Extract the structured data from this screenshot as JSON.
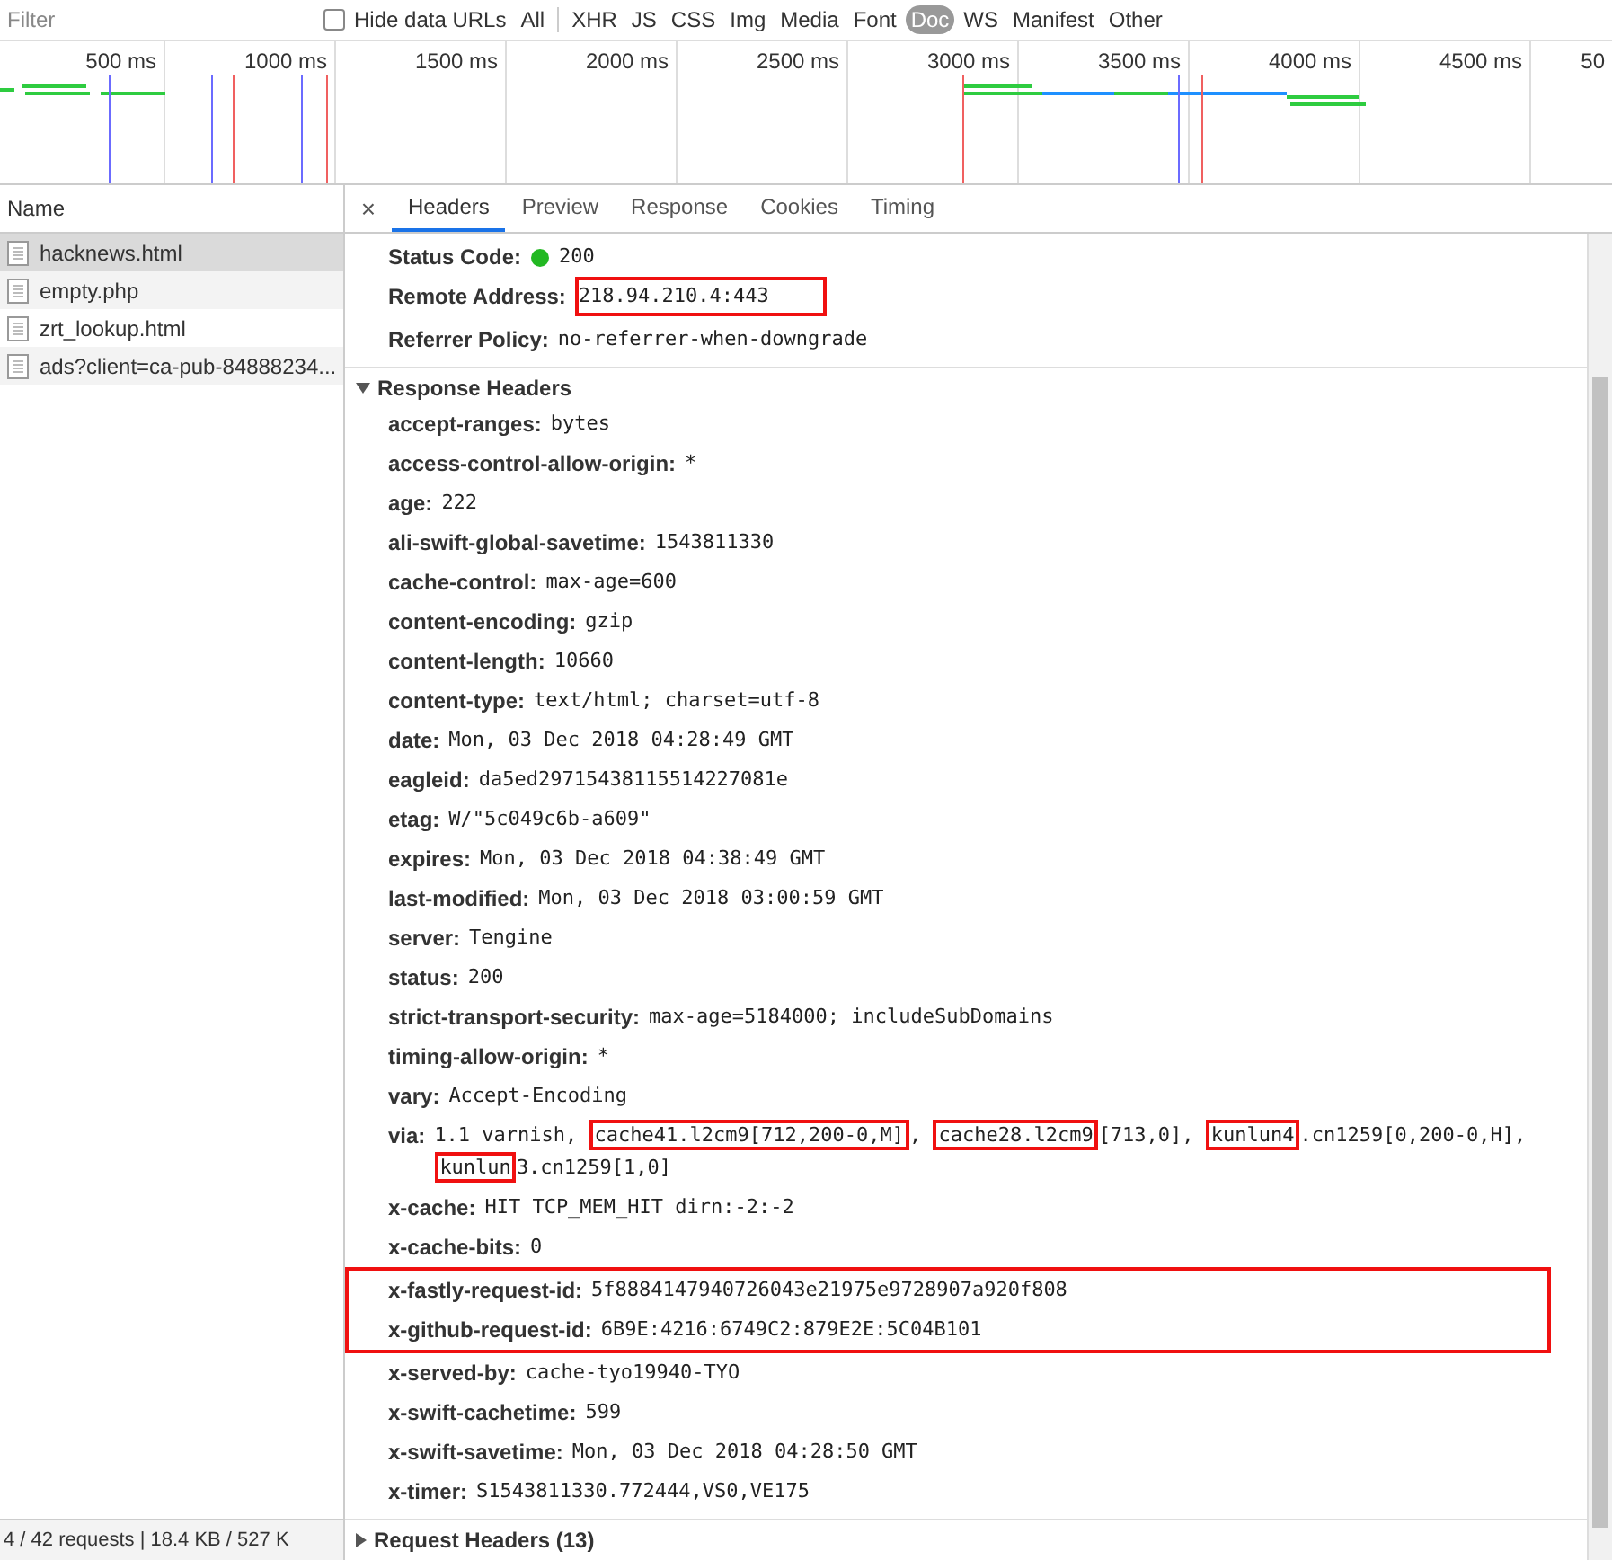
{
  "filter_bar": {
    "placeholder": "Filter",
    "hide_data_urls": {
      "label": "Hide data URLs",
      "checked": false
    },
    "types": [
      {
        "label": "All",
        "selected": false
      },
      {
        "label": "XHR",
        "selected": false
      },
      {
        "label": "JS",
        "selected": false
      },
      {
        "label": "CSS",
        "selected": false
      },
      {
        "label": "Img",
        "selected": false
      },
      {
        "label": "Media",
        "selected": false
      },
      {
        "label": "Font",
        "selected": false
      },
      {
        "label": "Doc",
        "selected": true
      },
      {
        "label": "WS",
        "selected": false
      },
      {
        "label": "Manifest",
        "selected": false
      },
      {
        "label": "Other",
        "selected": false
      }
    ]
  },
  "timeline": {
    "ticks": [
      "500 ms",
      "1000 ms",
      "1500 ms",
      "2000 ms",
      "2500 ms",
      "3000 ms",
      "3500 ms",
      "4000 ms",
      "4500 ms",
      "50"
    ]
  },
  "requests": {
    "header": "Name",
    "items": [
      {
        "name": "hacknews.html",
        "selected": true
      },
      {
        "name": "empty.php",
        "selected": false
      },
      {
        "name": "zrt_lookup.html",
        "selected": false
      },
      {
        "name": "ads?client=ca-pub-84888234...",
        "selected": false
      }
    ]
  },
  "details": {
    "close": "×",
    "tabs": [
      {
        "label": "Headers",
        "selected": true
      },
      {
        "label": "Preview",
        "selected": false
      },
      {
        "label": "Response",
        "selected": false
      },
      {
        "label": "Cookies",
        "selected": false
      },
      {
        "label": "Timing",
        "selected": false
      }
    ],
    "general": [
      {
        "kind": "status",
        "name": "Status Code:",
        "value": "200",
        "highlighted": false
      },
      {
        "kind": "text",
        "name": "Remote Address:",
        "value": "218.94.210.4:443",
        "highlighted": true
      },
      {
        "kind": "text",
        "name": "Referrer Policy:",
        "value": "no-referrer-when-downgrade",
        "highlighted": false
      }
    ],
    "response_headers": {
      "title": "Response Headers",
      "expanded": true,
      "headers": [
        {
          "name": "accept-ranges:",
          "segments": [
            {
              "text": "bytes",
              "highlighted": false
            }
          ],
          "highlighted": false
        },
        {
          "name": "access-control-allow-origin:",
          "segments": [
            {
              "text": "*",
              "highlighted": false
            }
          ],
          "highlighted": false
        },
        {
          "name": "age:",
          "segments": [
            {
              "text": "222",
              "highlighted": false
            }
          ],
          "highlighted": false
        },
        {
          "name": "ali-swift-global-savetime:",
          "segments": [
            {
              "text": "1543811330",
              "highlighted": false
            }
          ],
          "highlighted": false
        },
        {
          "name": "cache-control:",
          "segments": [
            {
              "text": "max-age=600",
              "highlighted": false
            }
          ],
          "highlighted": false
        },
        {
          "name": "content-encoding:",
          "segments": [
            {
              "text": "gzip",
              "highlighted": false
            }
          ],
          "highlighted": false
        },
        {
          "name": "content-length:",
          "segments": [
            {
              "text": "10660",
              "highlighted": false
            }
          ],
          "highlighted": false
        },
        {
          "name": "content-type:",
          "segments": [
            {
              "text": "text/html; charset=utf-8",
              "highlighted": false
            }
          ],
          "highlighted": false
        },
        {
          "name": "date:",
          "segments": [
            {
              "text": "Mon, 03 Dec 2018 04:28:49 GMT",
              "highlighted": false
            }
          ],
          "highlighted": false
        },
        {
          "name": "eagleid:",
          "segments": [
            {
              "text": "da5ed29715438115514227081e",
              "highlighted": false
            }
          ],
          "highlighted": false
        },
        {
          "name": "etag:",
          "segments": [
            {
              "text": "W/\"5c049c6b-a609\"",
              "highlighted": false
            }
          ],
          "highlighted": false
        },
        {
          "name": "expires:",
          "segments": [
            {
              "text": "Mon, 03 Dec 2018 04:38:49 GMT",
              "highlighted": false
            }
          ],
          "highlighted": false
        },
        {
          "name": "last-modified:",
          "segments": [
            {
              "text": "Mon, 03 Dec 2018 03:00:59 GMT",
              "highlighted": false
            }
          ],
          "highlighted": false
        },
        {
          "name": "server:",
          "segments": [
            {
              "text": "Tengine",
              "highlighted": false
            }
          ],
          "highlighted": false
        },
        {
          "name": "status:",
          "segments": [
            {
              "text": "200",
              "highlighted": false
            }
          ],
          "highlighted": false
        },
        {
          "name": "strict-transport-security:",
          "segments": [
            {
              "text": "max-age=5184000; includeSubDomains",
              "highlighted": false
            }
          ],
          "highlighted": false
        },
        {
          "name": "timing-allow-origin:",
          "segments": [
            {
              "text": "*",
              "highlighted": false
            }
          ],
          "highlighted": false
        },
        {
          "name": "vary:",
          "segments": [
            {
              "text": "Accept-Encoding",
              "highlighted": false
            }
          ],
          "highlighted": false
        },
        {
          "name": "via:",
          "segments": [
            {
              "text": "1.1 varnish, ",
              "highlighted": false
            },
            {
              "text": "cache41.l2cm9[712,200-0,M]",
              "highlighted": true
            },
            {
              "text": ", ",
              "highlighted": false
            },
            {
              "text": "cache28.l2cm9",
              "highlighted": true
            },
            {
              "text": "[713,0], ",
              "highlighted": false
            },
            {
              "text": "kunlun4",
              "highlighted": true
            },
            {
              "text": ".cn1259[0,200-0,H], ",
              "highlighted": false
            },
            {
              "text": "kunlun",
              "highlighted": true
            },
            {
              "text": "3.cn1259[1,0]",
              "highlighted": false
            }
          ],
          "highlighted": false
        },
        {
          "name": "x-cache:",
          "segments": [
            {
              "text": "HIT TCP_MEM_HIT dirn:-2:-2",
              "highlighted": false
            }
          ],
          "highlighted": false
        },
        {
          "name": "x-cache-bits:",
          "segments": [
            {
              "text": "0",
              "highlighted": false
            }
          ],
          "highlighted": false
        },
        {
          "name": "x-fastly-request-id:",
          "segments": [
            {
              "text": "5f8884147940726043e21975e9728907a920f808",
              "highlighted": false
            }
          ],
          "highlighted": true
        },
        {
          "name": "x-github-request-id:",
          "segments": [
            {
              "text": "6B9E:4216:6749C2:879E2E:5C04B101",
              "highlighted": false
            }
          ],
          "highlighted": true
        },
        {
          "name": "x-served-by:",
          "segments": [
            {
              "text": "cache-tyo19940-TYO",
              "highlighted": false
            }
          ],
          "highlighted": false
        },
        {
          "name": "x-swift-cachetime:",
          "segments": [
            {
              "text": "599",
              "highlighted": false
            }
          ],
          "highlighted": false
        },
        {
          "name": "x-swift-savetime:",
          "segments": [
            {
              "text": "Mon, 03 Dec 2018 04:28:50 GMT",
              "highlighted": false
            }
          ],
          "highlighted": false
        },
        {
          "name": "x-timer:",
          "segments": [
            {
              "text": "S1543811330.772444,VS0,VE175",
              "highlighted": false
            }
          ],
          "highlighted": false
        }
      ]
    },
    "request_headers": {
      "title": "Request Headers (13)",
      "expanded": false
    }
  },
  "status_bar": "4 / 42 requests | 18.4 KB / 527 K"
}
